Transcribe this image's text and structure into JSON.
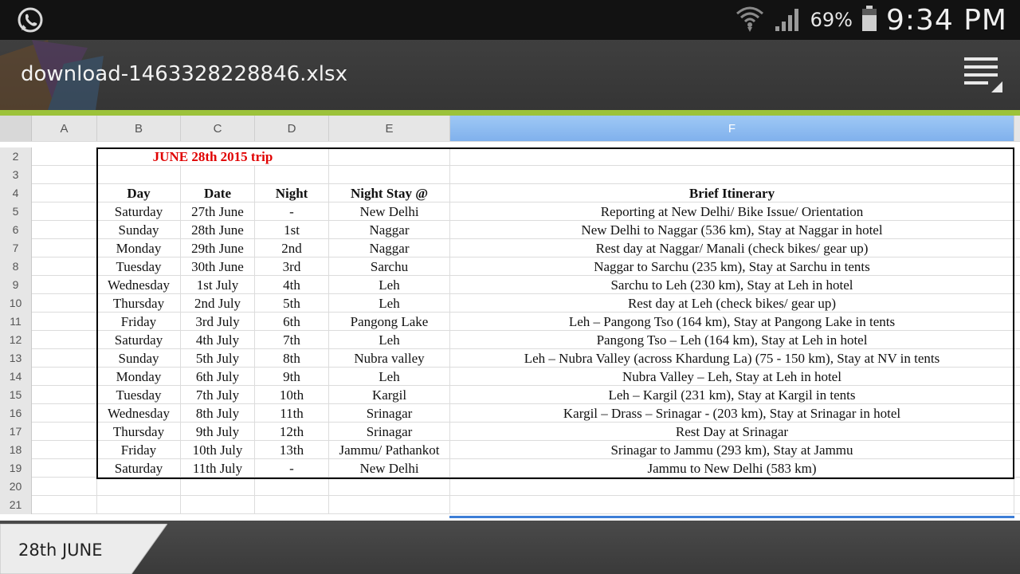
{
  "status_bar": {
    "app_icon": "whatsapp-icon",
    "battery_pct": "69%",
    "time": "9:34 PM"
  },
  "title_bar": {
    "filename": "download-1463328228846.xlsx",
    "menu_icon": "overflow-menu-icon"
  },
  "columns": [
    "A",
    "B",
    "C",
    "D",
    "E",
    "F"
  ],
  "selected_column": "F",
  "rows": [
    {
      "n": "2",
      "title": "JUNE 28th 2015 trip"
    },
    {
      "n": "3"
    },
    {
      "n": "4",
      "header": [
        "Day",
        "Date",
        "Night",
        "Night Stay @",
        "Brief Itinerary"
      ]
    },
    {
      "n": "5",
      "cells": [
        "Saturday",
        "27th June",
        "-",
        "New Delhi",
        "Reporting at New Delhi/ Bike Issue/ Orientation"
      ]
    },
    {
      "n": "6",
      "cells": [
        "Sunday",
        "28th June",
        "1st",
        "Naggar",
        "New Delhi to Naggar (536 km), Stay at Naggar in hotel"
      ]
    },
    {
      "n": "7",
      "cells": [
        "Monday",
        "29th June",
        "2nd",
        "Naggar",
        "Rest day at Naggar/ Manali (check bikes/ gear up)"
      ]
    },
    {
      "n": "8",
      "cells": [
        "Tuesday",
        "30th June",
        "3rd",
        "Sarchu",
        "Naggar to Sarchu (235 km), Stay at Sarchu in tents"
      ]
    },
    {
      "n": "9",
      "cells": [
        "Wednesday",
        "1st July",
        "4th",
        "Leh",
        "Sarchu to Leh (230 km), Stay at Leh in hotel"
      ]
    },
    {
      "n": "10",
      "cells": [
        "Thursday",
        "2nd July",
        "5th",
        "Leh",
        "Rest day at Leh (check bikes/ gear up)"
      ]
    },
    {
      "n": "11",
      "cells": [
        "Friday",
        "3rd July",
        "6th",
        "Pangong Lake",
        "Leh – Pangong Tso (164 km), Stay at Pangong Lake in tents"
      ]
    },
    {
      "n": "12",
      "cells": [
        "Saturday",
        "4th July",
        "7th",
        "Leh",
        "Pangong Tso – Leh (164 km), Stay at Leh in hotel"
      ]
    },
    {
      "n": "13",
      "cells": [
        "Sunday",
        "5th July",
        "8th",
        "Nubra valley",
        "Leh – Nubra Valley (across Khardung La) (75 - 150 km), Stay at NV in tents"
      ]
    },
    {
      "n": "14",
      "cells": [
        "Monday",
        "6th July",
        "9th",
        "Leh",
        "Nubra Valley – Leh, Stay at Leh in hotel"
      ]
    },
    {
      "n": "15",
      "cells": [
        "Tuesday",
        "7th July",
        "10th",
        "Kargil",
        "Leh – Kargil (231 km), Stay at Kargil in tents"
      ]
    },
    {
      "n": "16",
      "cells": [
        "Wednesday",
        "8th July",
        "11th",
        "Srinagar",
        "Kargil – Drass – Srinagar - (203 km), Stay at Srinagar in hotel"
      ]
    },
    {
      "n": "17",
      "cells": [
        "Thursday",
        "9th July",
        "12th",
        "Srinagar",
        "Rest Day at Srinagar"
      ]
    },
    {
      "n": "18",
      "cells": [
        "Friday",
        "10th July",
        "13th",
        "Jammu/ Pathankot",
        "Srinagar to Jammu (293 km), Stay at Jammu"
      ]
    },
    {
      "n": "19",
      "cells": [
        "Saturday",
        "11th July",
        "-",
        "New Delhi",
        "Jammu to New Delhi (583 km)"
      ]
    },
    {
      "n": "20"
    },
    {
      "n": "21"
    }
  ],
  "sheet_tabs": [
    {
      "label": "28th JUNE",
      "active": true
    }
  ]
}
